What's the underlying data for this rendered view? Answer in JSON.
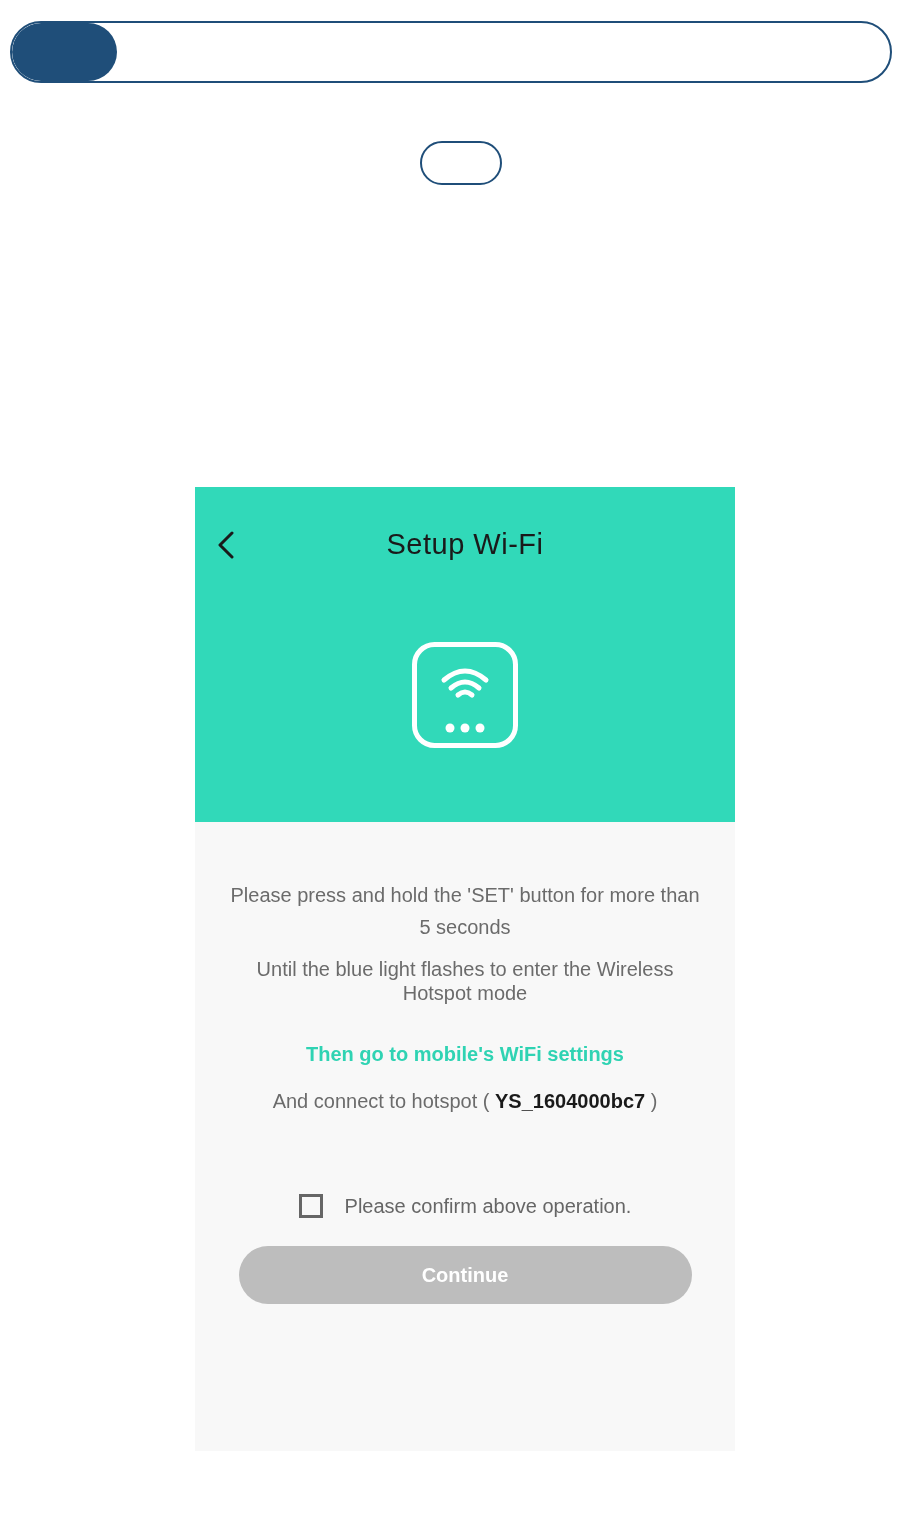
{
  "progress": {
    "level": 0.12
  },
  "phone": {
    "title": "Setup Wi-Fi",
    "instructions": [
      "Please press and hold the 'SET' button for more than 5 seconds",
      "Until the blue light flashes to enter the Wireless Hotspot mode"
    ],
    "settings_link": "Then go to mobile's WiFi settings",
    "hotspot": "And connect to hotspot ( **YS_1604000bc7** )",
    "confirm": {
      "label": "Please confirm above operation.",
      "checked": false
    },
    "continue_button": {
      "label": "Continue",
      "disabled": true
    }
  }
}
